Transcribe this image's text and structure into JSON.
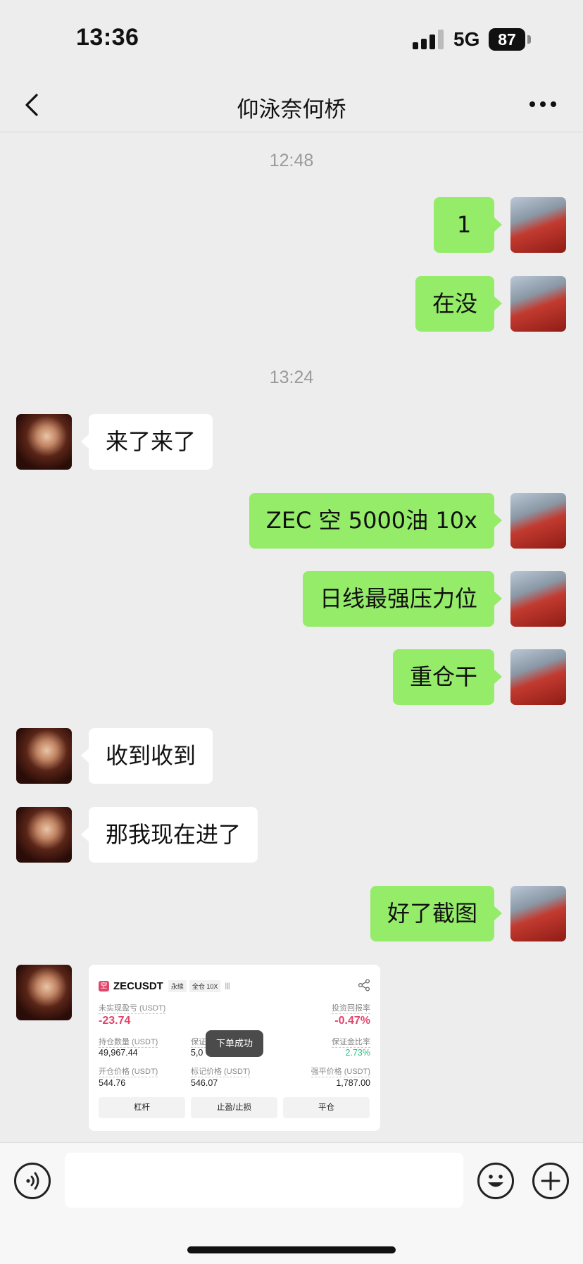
{
  "status": {
    "time": "13:36",
    "network": "5G",
    "battery": "87"
  },
  "nav": {
    "title": "仰泳奈何桥"
  },
  "timestamps": [
    "12:48",
    "13:24"
  ],
  "messages": [
    {
      "from": "me",
      "text": "1"
    },
    {
      "from": "me",
      "text": "在没"
    },
    {
      "from": "them",
      "text": "来了来了"
    },
    {
      "from": "me",
      "text": "ZEC 空 5000油 10x"
    },
    {
      "from": "me",
      "text": "日线最强压力位"
    },
    {
      "from": "me",
      "text": "重仓干"
    },
    {
      "from": "them",
      "text": "收到收到"
    },
    {
      "from": "them",
      "text": "那我现在进了"
    },
    {
      "from": "me",
      "text": "好了截图"
    }
  ],
  "card": {
    "badge": "空",
    "symbol": "ZECUSDT",
    "tag_perp": "永续",
    "tag_margin": "全仓 10X",
    "bars": "||||",
    "unrealized_label": "未实现盈亏 (USDT)",
    "unrealized_value": "-23.74",
    "roi_label": "投资回报率",
    "roi_value": "-0.47%",
    "position_label": "持仓数量 (USDT)",
    "position_value": "49,967.44",
    "margin_label": "保证",
    "margin_value": "5,0",
    "margin_ratio_label": "保证金比率",
    "margin_ratio_value": "2.73%",
    "entry_label": "开仓价格 (USDT)",
    "entry_value": "544.76",
    "mark_label": "标记价格 (USDT)",
    "mark_value": "546.07",
    "liq_label": "强平价格 (USDT)",
    "liq_value": "1,787.00",
    "toast": "下单成功",
    "btn_leverage": "杠杆",
    "btn_tpsl": "止盈/止损",
    "btn_close": "平仓"
  },
  "input": {
    "placeholder": ""
  }
}
